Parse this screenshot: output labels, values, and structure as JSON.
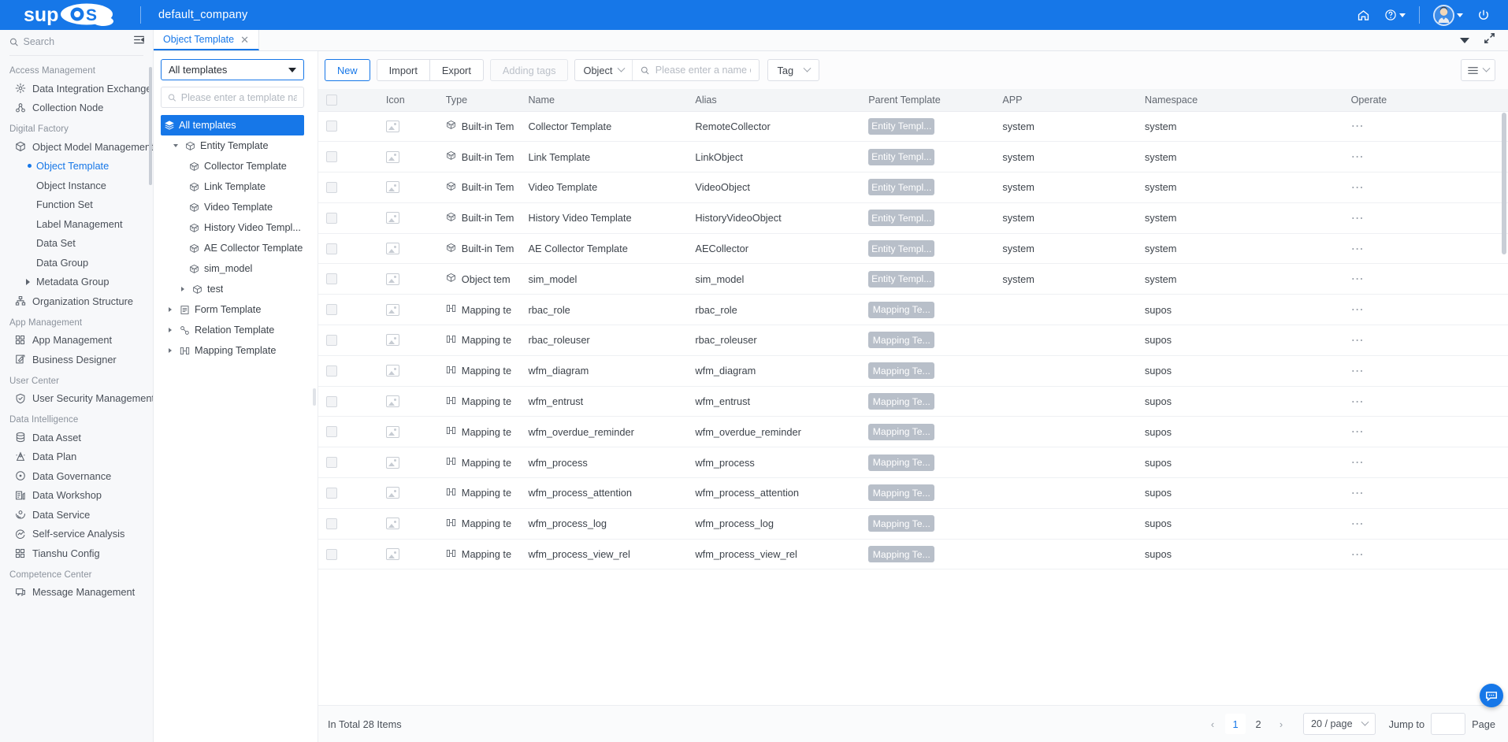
{
  "topbar": {
    "brand": "supOS",
    "company": "default_company",
    "icons": [
      "home-icon",
      "help-icon",
      "avatar",
      "power-icon"
    ]
  },
  "sidebar": {
    "search_placeholder": "Search",
    "collapse_icon": "collapse-panel-icon",
    "groups": [
      {
        "title": "Access Management",
        "items": [
          {
            "label": "Data Integration Exchange",
            "icon": "data-exchange-icon",
            "type": "item"
          },
          {
            "label": "Collection Node",
            "icon": "collection-node-icon",
            "type": "item"
          }
        ]
      },
      {
        "title": "Digital Factory",
        "items": [
          {
            "label": "Object Model Management",
            "icon": "cube-icon",
            "type": "item"
          },
          {
            "label": "Object Template",
            "type": "sub",
            "active": true
          },
          {
            "label": "Object Instance",
            "type": "sub"
          },
          {
            "label": "Function Set",
            "type": "sub"
          },
          {
            "label": "Label Management",
            "type": "sub"
          },
          {
            "label": "Data Set",
            "type": "sub"
          },
          {
            "label": "Data Group",
            "type": "sub"
          },
          {
            "label": "Metadata Group",
            "type": "sub",
            "expandable": true
          },
          {
            "label": "Organization Structure",
            "icon": "org-structure-icon",
            "type": "item"
          }
        ]
      },
      {
        "title": "App Management",
        "items": [
          {
            "label": "App Management",
            "icon": "grid-icon",
            "type": "item"
          },
          {
            "label": "Business Designer",
            "icon": "pen-square-icon",
            "type": "item"
          }
        ]
      },
      {
        "title": "User Center",
        "items": [
          {
            "label": "User Security Management",
            "icon": "shield-check-icon",
            "type": "item"
          }
        ]
      },
      {
        "title": "Data Intelligence",
        "items": [
          {
            "label": "Data Asset",
            "icon": "database-icon",
            "type": "item"
          },
          {
            "label": "Data Plan",
            "icon": "data-plan-icon",
            "type": "item"
          },
          {
            "label": "Data Governance",
            "icon": "target-icon",
            "type": "item"
          },
          {
            "label": "Data Workshop",
            "icon": "workshop-icon",
            "type": "item"
          },
          {
            "label": "Data Service",
            "icon": "service-icon",
            "type": "item"
          },
          {
            "label": "Self-service Analysis",
            "icon": "analysis-icon",
            "type": "item"
          },
          {
            "label": "Tianshu Config",
            "icon": "grid-icon",
            "type": "item"
          }
        ]
      },
      {
        "title": "Competence Center",
        "items": [
          {
            "label": "Message Management",
            "icon": "message-icon",
            "type": "item"
          }
        ]
      }
    ]
  },
  "tabs": {
    "items": [
      {
        "label": "Object Template",
        "close_icon": "close-icon",
        "active": true
      }
    ],
    "right_icons": [
      "chevron-down-icon",
      "expand-icon"
    ]
  },
  "tree_panel": {
    "selector_value": "All templates",
    "search_placeholder": "Please enter a template na",
    "nodes": [
      {
        "label": "All templates",
        "icon": "layers-icon",
        "level": 0,
        "selected": true,
        "expander": "none"
      },
      {
        "label": "Entity Template",
        "icon": "cube-outline-icon",
        "level": 1,
        "expander": "open"
      },
      {
        "label": "Collector Template",
        "icon": "cube-3d-icon",
        "level": 2,
        "expander": "none"
      },
      {
        "label": "Link Template",
        "icon": "cube-3d-icon",
        "level": 2,
        "expander": "none"
      },
      {
        "label": "Video Template",
        "icon": "cube-3d-icon",
        "level": 2,
        "expander": "none"
      },
      {
        "label": "History Video Templ...",
        "icon": "cube-3d-icon",
        "level": 2,
        "expander": "none"
      },
      {
        "label": "AE Collector Template",
        "icon": "cube-3d-icon",
        "level": 2,
        "expander": "none"
      },
      {
        "label": "sim_model",
        "icon": "cube-3d-icon",
        "level": 2,
        "expander": "none"
      },
      {
        "label": "test",
        "icon": "cube-outline-icon",
        "level": 1,
        "expander": "closed"
      },
      {
        "label": "Form Template",
        "icon": "form-icon",
        "level": 0,
        "expander": "closed"
      },
      {
        "label": "Relation Template",
        "icon": "relation-icon",
        "level": 0,
        "expander": "closed"
      },
      {
        "label": "Mapping Template",
        "icon": "mapping-icon",
        "level": 0,
        "expander": "closed"
      }
    ]
  },
  "toolbar": {
    "new_label": "New",
    "import_label": "Import",
    "export_label": "Export",
    "adding_tags_label": "Adding tags",
    "object_select_value": "Object",
    "search_placeholder": "Please enter a name or alias",
    "tag_label": "Tag",
    "settings_icon": "list-settings-icon"
  },
  "table": {
    "columns": [
      "Icon",
      "Type",
      "Name",
      "Alias",
      "Parent Template",
      "APP",
      "Namespace",
      "Operate"
    ],
    "rows": [
      {
        "type": "Built-in Tem",
        "type_icon": "cube-3d-icon",
        "name": "Collector Template",
        "alias": "RemoteCollector",
        "parent": "Entity Templ...",
        "app": "system",
        "namespace": "system"
      },
      {
        "type": "Built-in Tem",
        "type_icon": "cube-3d-icon",
        "name": "Link Template",
        "alias": "LinkObject",
        "parent": "Entity Templ...",
        "app": "system",
        "namespace": "system"
      },
      {
        "type": "Built-in Tem",
        "type_icon": "cube-3d-icon",
        "name": "Video Template",
        "alias": "VideoObject",
        "parent": "Entity Templ...",
        "app": "system",
        "namespace": "system"
      },
      {
        "type": "Built-in Tem",
        "type_icon": "cube-3d-icon",
        "name": "History Video Template",
        "alias": "HistoryVideoObject",
        "parent": "Entity Templ...",
        "app": "system",
        "namespace": "system"
      },
      {
        "type": "Built-in Tem",
        "type_icon": "cube-3d-icon",
        "name": "AE Collector Template",
        "alias": "AECollector",
        "parent": "Entity Templ...",
        "app": "system",
        "namespace": "system"
      },
      {
        "type": "Object tem",
        "type_icon": "cube-outline-icon",
        "name": "sim_model",
        "alias": "sim_model",
        "parent": "Entity Templ...",
        "app": "system",
        "namespace": "system"
      },
      {
        "type": "Mapping te",
        "type_icon": "mapping-icon",
        "name": "rbac_role",
        "alias": "rbac_role",
        "parent": "Mapping Te...",
        "app": "",
        "namespace": "supos"
      },
      {
        "type": "Mapping te",
        "type_icon": "mapping-icon",
        "name": "rbac_roleuser",
        "alias": "rbac_roleuser",
        "parent": "Mapping Te...",
        "app": "",
        "namespace": "supos"
      },
      {
        "type": "Mapping te",
        "type_icon": "mapping-icon",
        "name": "wfm_diagram",
        "alias": "wfm_diagram",
        "parent": "Mapping Te...",
        "app": "",
        "namespace": "supos"
      },
      {
        "type": "Mapping te",
        "type_icon": "mapping-icon",
        "name": "wfm_entrust",
        "alias": "wfm_entrust",
        "parent": "Mapping Te...",
        "app": "",
        "namespace": "supos"
      },
      {
        "type": "Mapping te",
        "type_icon": "mapping-icon",
        "name": "wfm_overdue_reminder",
        "alias": "wfm_overdue_reminder",
        "parent": "Mapping Te...",
        "app": "",
        "namespace": "supos"
      },
      {
        "type": "Mapping te",
        "type_icon": "mapping-icon",
        "name": "wfm_process",
        "alias": "wfm_process",
        "parent": "Mapping Te...",
        "app": "",
        "namespace": "supos"
      },
      {
        "type": "Mapping te",
        "type_icon": "mapping-icon",
        "name": "wfm_process_attention",
        "alias": "wfm_process_attention",
        "parent": "Mapping Te...",
        "app": "",
        "namespace": "supos"
      },
      {
        "type": "Mapping te",
        "type_icon": "mapping-icon",
        "name": "wfm_process_log",
        "alias": "wfm_process_log",
        "parent": "Mapping Te...",
        "app": "",
        "namespace": "supos"
      },
      {
        "type": "Mapping te",
        "type_icon": "mapping-icon",
        "name": "wfm_process_view_rel",
        "alias": "wfm_process_view_rel",
        "parent": "Mapping Te...",
        "app": "",
        "namespace": "supos"
      }
    ]
  },
  "footer": {
    "total_text": "In Total 28 Items",
    "prev_icon": "chevron-left-icon",
    "next_icon": "chevron-right-icon",
    "pages": [
      "1",
      "2"
    ],
    "active_page": "1",
    "page_size": "20 / page",
    "jump_to_label": "Jump to",
    "jump_value": "",
    "page_label": "Page"
  },
  "colors": {
    "brand_blue": "#1677e8",
    "badge_gray": "#b8bfc9"
  }
}
